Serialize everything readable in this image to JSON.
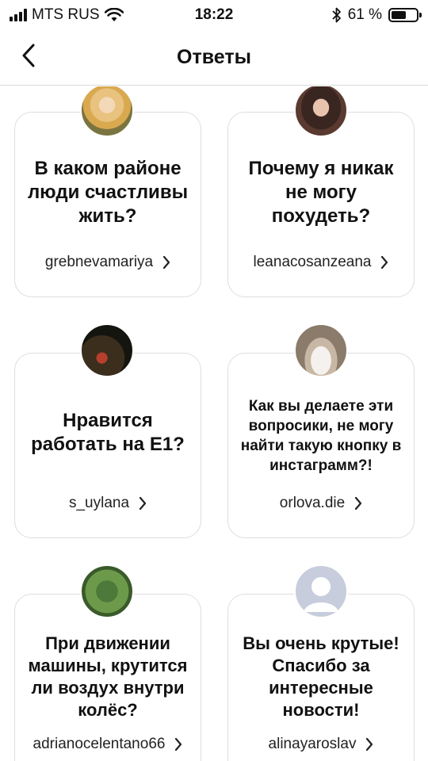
{
  "status_bar": {
    "carrier": "MTS RUS",
    "time": "18:22",
    "battery_text": "61 %",
    "battery_level": 0.61
  },
  "nav": {
    "title": "Ответы",
    "back_icon": "chevron-left-icon"
  },
  "cards": [
    {
      "question": "В каком районе люди счастливы жить?",
      "author": "grebnevamariya"
    },
    {
      "question": "Почему я никак не могу похудеть?",
      "author": "leanacosanzeana"
    },
    {
      "question": "Нравится работать на Е1?",
      "author": "s_uylana"
    },
    {
      "question": "Как вы делаете эти вопросики, не могу найти такую кнопку в инстаграмм?!",
      "author": "orlova.die"
    },
    {
      "question": "При движении машины, крутится ли воздух внутри колёс?",
      "author": "adrianocelentano66"
    },
    {
      "question": "Вы очень крутые! Спасибо за интересные новости!",
      "author": "alinayaroslav"
    }
  ],
  "colors": {
    "card_border": "#dedede",
    "divider": "#dbdbdb",
    "text": "#111111"
  }
}
